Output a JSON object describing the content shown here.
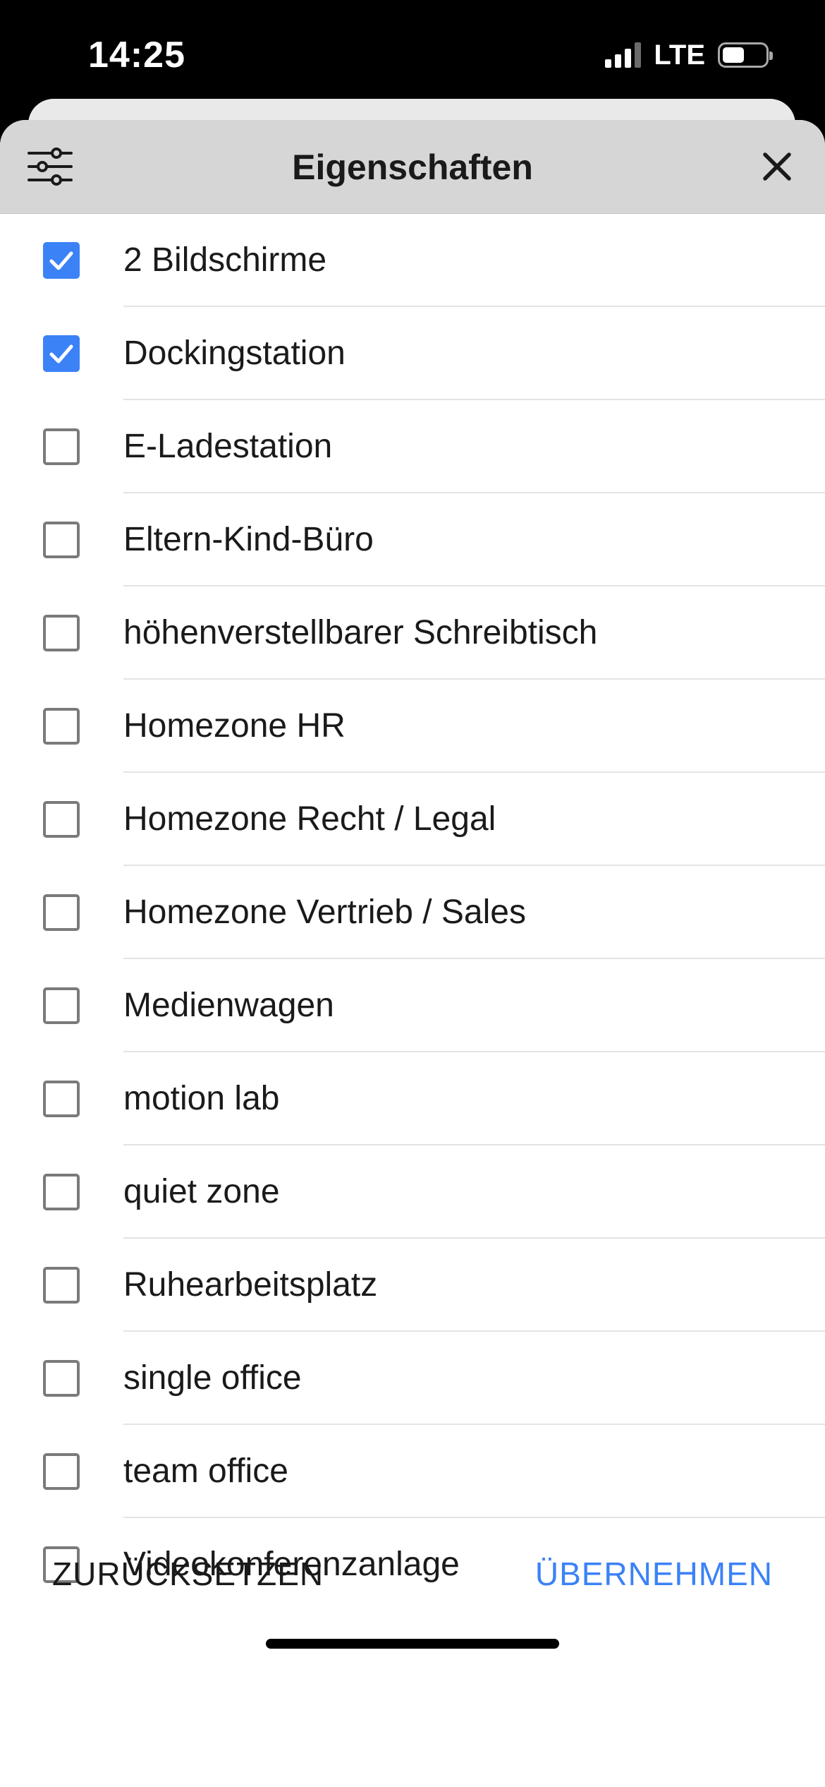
{
  "status_bar": {
    "time": "14:25",
    "network": "LTE",
    "signal_bars_active": 3,
    "signal_bars_total": 4,
    "battery_level": 0.5
  },
  "sheet": {
    "title": "Eigenschaften",
    "filter_icon": "sliders-icon",
    "close_icon": "close-icon",
    "items": [
      {
        "label": "2 Bildschirme",
        "checked": true
      },
      {
        "label": "Dockingstation",
        "checked": true
      },
      {
        "label": "E-Ladestation",
        "checked": false
      },
      {
        "label": "Eltern-Kind-Büro",
        "checked": false
      },
      {
        "label": "höhenverstellbarer Schreibtisch",
        "checked": false
      },
      {
        "label": "Homezone HR",
        "checked": false
      },
      {
        "label": "Homezone Recht / Legal",
        "checked": false
      },
      {
        "label": "Homezone Vertrieb / Sales",
        "checked": false
      },
      {
        "label": "Medienwagen",
        "checked": false
      },
      {
        "label": "motion lab",
        "checked": false
      },
      {
        "label": "quiet zone",
        "checked": false
      },
      {
        "label": "Ruhearbeitsplatz",
        "checked": false
      },
      {
        "label": "single office",
        "checked": false
      },
      {
        "label": "team office",
        "checked": false
      },
      {
        "label": "Videokonferenzanlage",
        "checked": false
      }
    ]
  },
  "footer": {
    "reset_label": "ZURÜCKSETZEN",
    "apply_label": "ÜBERNEHMEN"
  },
  "colors": {
    "accent": "#3b82f6",
    "header_bg": "#d6d6d6",
    "text": "#1a1a1a",
    "checkbox_border": "#7a7a7a"
  }
}
